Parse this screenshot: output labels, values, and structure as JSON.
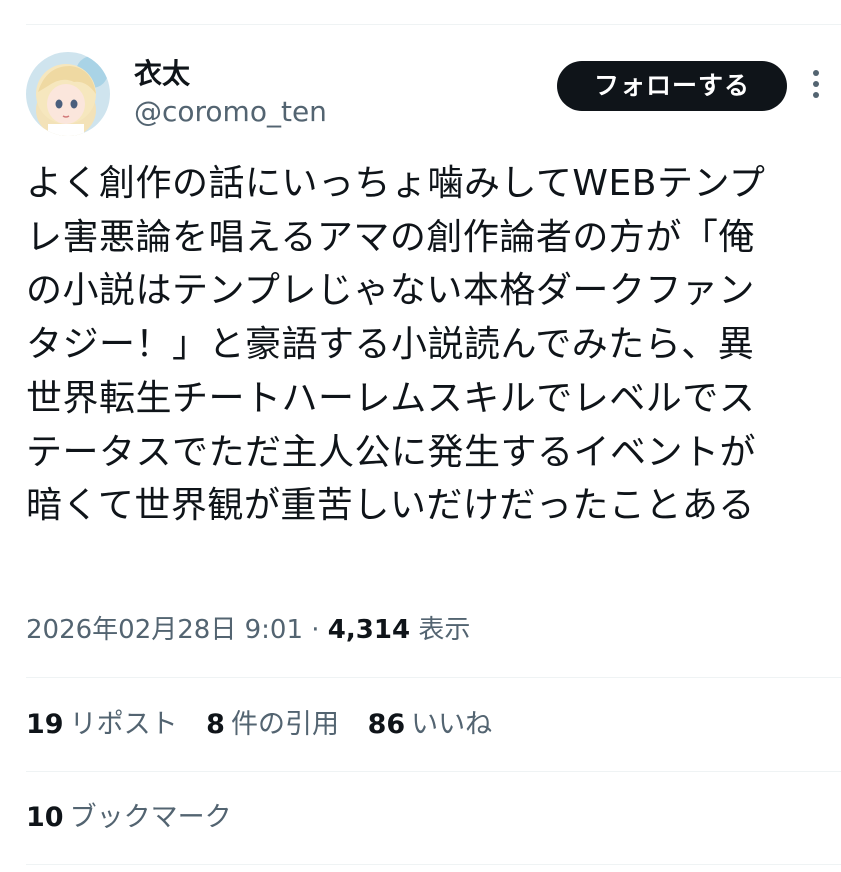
{
  "author": {
    "display_name": "衣太",
    "handle": "@coromo_ten",
    "avatar_icon": "avatar-anime-girl"
  },
  "follow_button": {
    "label": "フォローする",
    "background": "#0f1419",
    "text_color": "#ffffff"
  },
  "more_menu": {
    "icon": "vertical-dots-icon"
  },
  "tweet": {
    "text": "よく創作の話にいっちょ噛みしてWEBテンプ\nレ害悪論を唱えるアマの創作論者の方が「俺\nの小説はテンプレじゃない本格ダークファン\nタジー！」と豪語する小説読んでみたら、異\n世界転生チートハーレムスキルでレベルでス\nテータスでただ主人公に発生するイベントが\n暗くて世界観が重苦しいだけだったことある"
  },
  "meta": {
    "timestamp": "2026年02月28日 9:01",
    "separator": "·",
    "views_count": "4,314",
    "views_label": "表示"
  },
  "stats": {
    "reposts_count": "19",
    "reposts_label": "リポスト",
    "quotes_count": "8",
    "quotes_label": "件の引用",
    "likes_count": "86",
    "likes_label": "いいね",
    "bookmarks_count": "10",
    "bookmarks_label": "ブックマーク"
  },
  "colors": {
    "primary_text": "#0f1419",
    "secondary_text": "#536471",
    "divider": "#eff3f4"
  }
}
